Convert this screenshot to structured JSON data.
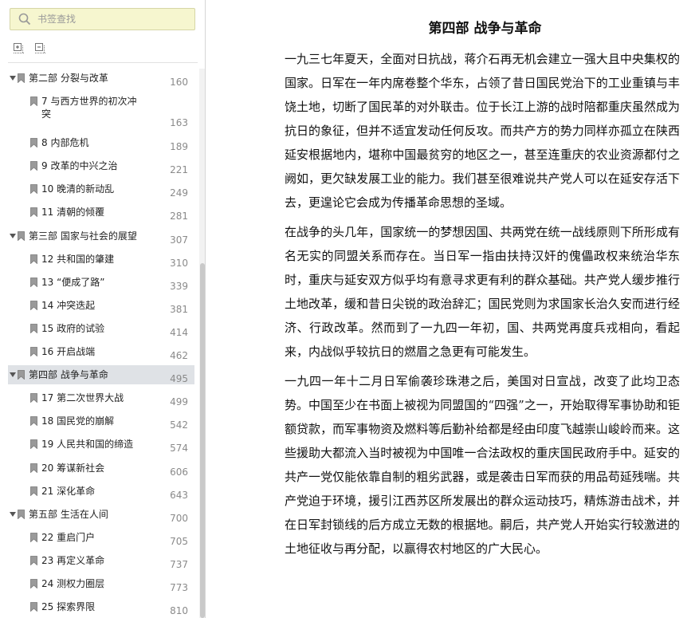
{
  "sidebar": {
    "search": {
      "placeholder": "书签查找"
    },
    "toolbar": {
      "expand_icon": "expand-all-icon",
      "collapse_icon": "collapse-all-icon"
    },
    "toc": [
      {
        "label": "第二部 分裂与改革",
        "page": "160",
        "level": 1
      },
      {
        "label": "7 与西方世界的初次冲突",
        "page": "163",
        "level": 2
      },
      {
        "label": "8 内部危机",
        "page": "189",
        "level": 2
      },
      {
        "label": "9 改革的中兴之治",
        "page": "221",
        "level": 2
      },
      {
        "label": "10 晚清的新动乱",
        "page": "249",
        "level": 2
      },
      {
        "label": "11 清朝的倾覆",
        "page": "281",
        "level": 2
      },
      {
        "label": "第三部 国家与社会的展望",
        "page": "307",
        "level": 1
      },
      {
        "label": "12 共和国的肇建",
        "page": "310",
        "level": 2
      },
      {
        "label": "13 “便成了路”",
        "page": "339",
        "level": 2
      },
      {
        "label": "14 冲突迭起",
        "page": "381",
        "level": 2
      },
      {
        "label": "15 政府的试验",
        "page": "414",
        "level": 2
      },
      {
        "label": "16 开启战端",
        "page": "462",
        "level": 2
      },
      {
        "label": "第四部 战争与革命",
        "page": "495",
        "level": 1,
        "selected": true
      },
      {
        "label": "17 第二次世界大战",
        "page": "499",
        "level": 2
      },
      {
        "label": "18 国民党的崩解",
        "page": "542",
        "level": 2
      },
      {
        "label": "19 人民共和国的缔造",
        "page": "574",
        "level": 2
      },
      {
        "label": "20 筹谋新社会",
        "page": "606",
        "level": 2
      },
      {
        "label": "21 深化革命",
        "page": "643",
        "level": 2
      },
      {
        "label": "第五部 生活在人间",
        "page": "700",
        "level": 1
      },
      {
        "label": "22 重启门户",
        "page": "705",
        "level": 2
      },
      {
        "label": "23 再定义革命",
        "page": "737",
        "level": 2
      },
      {
        "label": "24 测权力圈层",
        "page": "773",
        "level": 2
      },
      {
        "label": "25 探索界限",
        "page": "810",
        "level": 2
      }
    ]
  },
  "content": {
    "title": "第四部 战争与革命",
    "paragraphs": [
      "一九三七年夏天，全面对日抗战，蒋介石再无机会建立一强大且中央集权的国家。日军在一年内席卷整个华东，占领了昔日国民党治下的工业重镇与丰饶土地，切断了国民革的对外联击。位于长江上游的战时陪都重庆虽然成为抗日的象征，但并不适宜发动任何反攻。而共产方的势力同样亦孤立在陕西延安根据地内，堪称中国最贫穷的地区之一，甚至连重庆的农业资源都付之阙如，更欠缺发展工业的能力。我们甚至很难说共产党人可以在延安存活下去，更遑论它会成为传播革命思想的圣域。",
      "在战争的头几年，国家统一的梦想因国、共两党在统一战线原则下所形成有名无实的同盟关系而存在。当日军一指由扶持汉奸的傀儡政权来统治华东时，重庆与延安双方似乎均有意寻求更有利的群众基础。共产党人缓步推行土地改革，缓和昔日尖锐的政治辞汇；国民党则为求国家长治久安而进行经济、行政改革。然而到了一九四一年初，国、共两党再度兵戎相向，看起来，内战似乎较抗日的燃眉之急更有可能发生。",
      "一九四一年十二月日军偷袭珍珠港之后，美国对日宣战，改变了此均卫态势。中国至少在书面上被视为同盟国的“四强”之一，开始取得军事协助和钜额贷款，而军事物资及燃料等后勤补给都是经由印度飞越崇山峻岭而来。这些援助大都流入当时被视为中国唯一合法政权的重庆国民政府手中。延安的共产一党仅能依靠自制的粗劣武器，或是袭击日军而获的用品苟延残喘。共产党迫于环境，援引江西苏区所发展出的群众运动技巧，精炼游击战术，并在日军封锁线的后方成立无数的根据地。嗣后，共产党人开始实行较激进的土地征收与再分配，以赢得农村地区的广大民心。"
    ]
  }
}
